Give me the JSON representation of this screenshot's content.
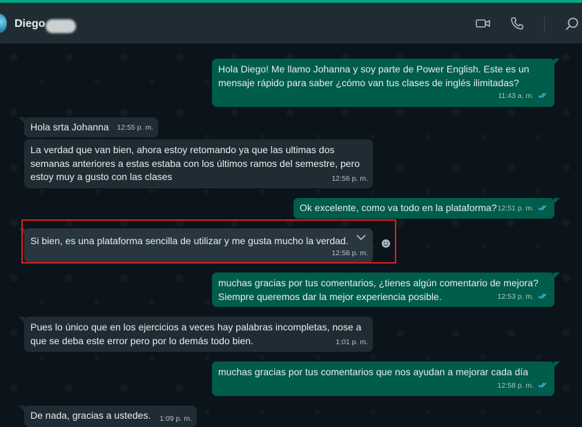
{
  "header": {
    "contact_name": "Diego",
    "icons": [
      "video-call-icon",
      "voice-call-icon",
      "search-icon"
    ]
  },
  "messages": [
    {
      "direction": "outgoing",
      "text": "Hola Diego! Me llamo Johanna y soy parte de Power English. Este es un\nmensaje rápido para saber ¿cómo van tus clases de inglés ilimitadas?",
      "time": "11:43 a. m.",
      "read": true
    },
    {
      "direction": "incoming",
      "text": "Hola srta Johanna",
      "time": "12:55 p. m."
    },
    {
      "direction": "incoming",
      "text": "La verdad que van bien, ahora estoy retomando ya que las ultimas dos\nsemanas anteriores a estas estaba con los últimos ramos del semestre, pero\nestoy muy a gusto con las clases",
      "time": "12:56 p. m."
    },
    {
      "direction": "outgoing",
      "text": "Ok excelente, como va todo en la plataforma?",
      "time": "12:51 p. m.",
      "read": true
    },
    {
      "direction": "incoming",
      "text": "Si bien, es una plataforma sencilla de utilizar y me gusta mucho la verdad.",
      "time": "12:58 p. m.",
      "highlighted": true
    },
    {
      "direction": "outgoing",
      "text": "muchas gracias por tus comentarios, ¿tienes algún comentario de mejora?\nSiempre queremos dar la mejor experiencia posible.",
      "time": "12:53 p. m.",
      "read": true
    },
    {
      "direction": "incoming",
      "text": "Pues lo único que en los ejercicios a veces hay palabras incompletas, nose a\nque se deba este error pero por lo demás todo bien.",
      "time": "1:01 p. m."
    },
    {
      "direction": "outgoing",
      "text": "muchas gracias por tus comentarios que nos ayudan a mejorar cada día",
      "time": "12:58 p. m.",
      "read": true
    },
    {
      "direction": "incoming",
      "text": "De nada, gracias a ustedes.",
      "time": "1:09 p. m."
    }
  ],
  "colors": {
    "accent": "#00a884",
    "header_bg": "#202c33",
    "chat_bg": "#0b141a",
    "incoming_bubble": "#202c33",
    "outgoing_bubble": "#005c4b",
    "read_ticks": "#53bdeb",
    "highlight_border": "#e01f1f"
  }
}
